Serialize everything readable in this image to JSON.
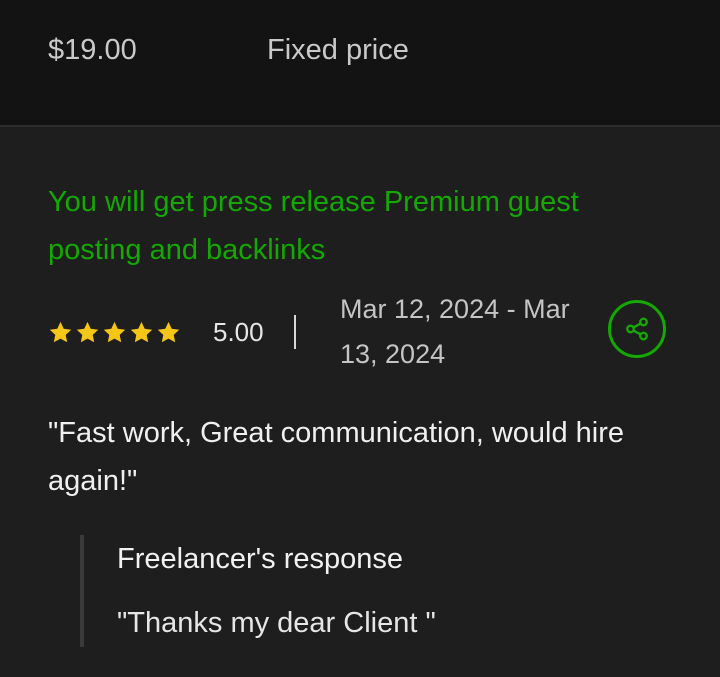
{
  "header": {
    "price": "$19.00",
    "price_type": "Fixed price"
  },
  "review": {
    "job_title": "You will get press release Premium guest posting and backlinks",
    "stars": 5,
    "score": "5.00",
    "date_range": "Mar 12, 2024 - Mar 13, 2024",
    "comment": "\"Fast work, Great communication, would hire again!\""
  },
  "response": {
    "heading": "Freelancer's response",
    "text": "\"Thanks my dear Client \""
  },
  "icons": {
    "star": "star-icon",
    "share": "share-icon"
  },
  "colors": {
    "accent": "#14a800",
    "star": "#f5c518",
    "background": "#1e1e1e",
    "header_background": "#131313"
  }
}
